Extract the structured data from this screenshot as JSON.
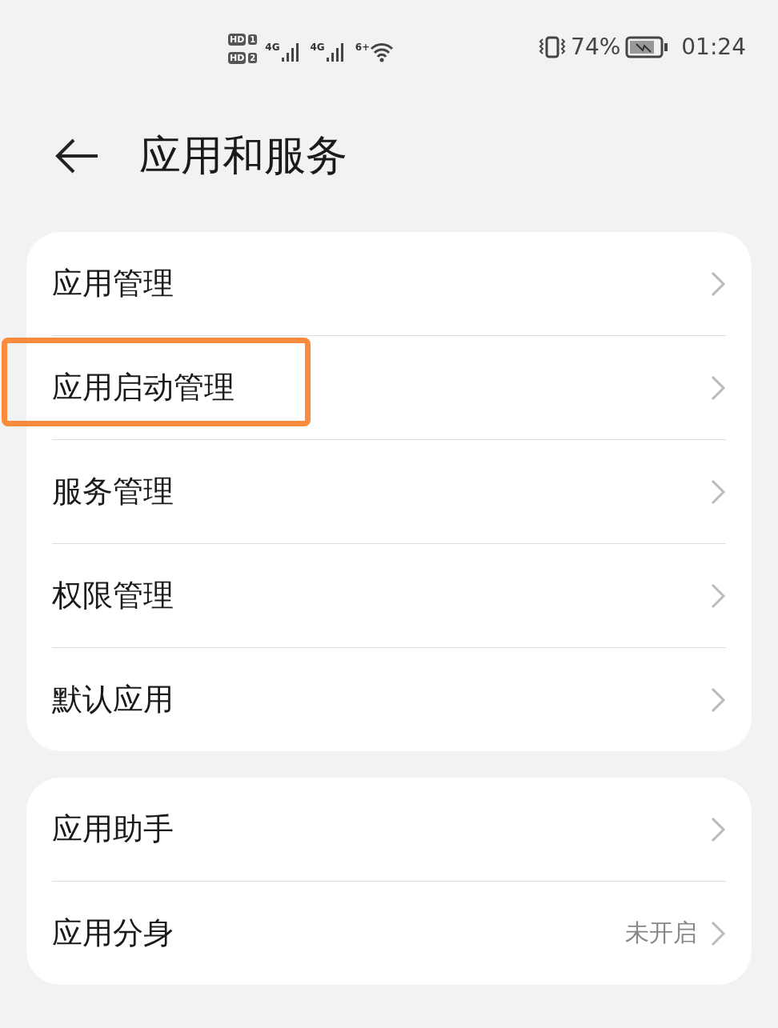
{
  "status_bar": {
    "sims": [
      {
        "label": "HD",
        "slot": "1"
      },
      {
        "label": "HD",
        "slot": "2"
      }
    ],
    "networks": [
      "4G",
      "4G"
    ],
    "wifi": "6+",
    "battery": "74%",
    "time": "01:24"
  },
  "header": {
    "title": "应用和服务"
  },
  "groups": [
    {
      "items": [
        {
          "label": "应用管理",
          "highlighted": false
        },
        {
          "label": "应用启动管理",
          "highlighted": true
        },
        {
          "label": "服务管理",
          "highlighted": false
        },
        {
          "label": "权限管理",
          "highlighted": false
        },
        {
          "label": "默认应用",
          "highlighted": false
        }
      ]
    },
    {
      "items": [
        {
          "label": "应用助手",
          "highlighted": false
        },
        {
          "label": "应用分身",
          "value": "未开启",
          "highlighted": false
        }
      ]
    }
  ]
}
